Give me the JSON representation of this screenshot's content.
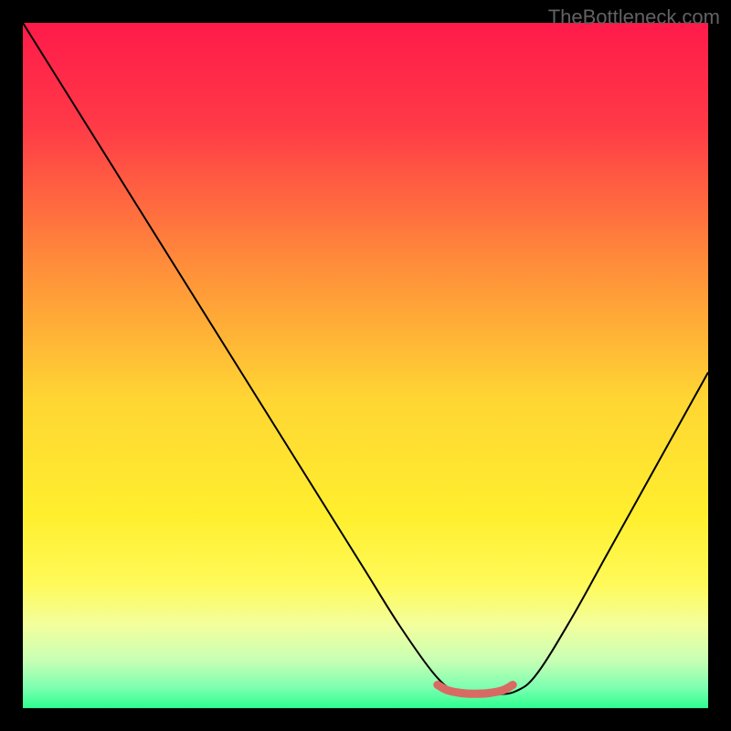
{
  "watermark": "TheBottleneck.com",
  "chart_data": {
    "type": "line",
    "title": "",
    "xlabel": "",
    "ylabel": "",
    "xlim": [
      0,
      100
    ],
    "ylim": [
      0,
      100
    ],
    "background_gradient": {
      "stops": [
        {
          "pos": 0.0,
          "color": "#ff1a4a"
        },
        {
          "pos": 0.15,
          "color": "#ff3a47"
        },
        {
          "pos": 0.35,
          "color": "#ff8c3a"
        },
        {
          "pos": 0.55,
          "color": "#ffd633"
        },
        {
          "pos": 0.72,
          "color": "#ffef2e"
        },
        {
          "pos": 0.82,
          "color": "#fffa5a"
        },
        {
          "pos": 0.88,
          "color": "#f2ff9e"
        },
        {
          "pos": 0.93,
          "color": "#c8ffb4"
        },
        {
          "pos": 0.97,
          "color": "#7dffb0"
        },
        {
          "pos": 1.0,
          "color": "#2dff8f"
        }
      ]
    },
    "series": [
      {
        "name": "bottleneck-curve",
        "color": "#000000",
        "width": 2,
        "x": [
          0,
          5,
          10,
          15,
          20,
          25,
          30,
          35,
          40,
          45,
          50,
          55,
          60,
          63,
          66,
          69,
          72,
          75,
          80,
          85,
          90,
          95,
          100
        ],
        "y": [
          100,
          92,
          84,
          76,
          68,
          60,
          52,
          44,
          36,
          28,
          20,
          12,
          5,
          2.5,
          2,
          2,
          2.5,
          5,
          13,
          22,
          31,
          40,
          49
        ]
      },
      {
        "name": "optimal-range-marker",
        "color": "#d96a63",
        "width": 9,
        "linecap": "round",
        "x": [
          60.5,
          62,
          64,
          66,
          68,
          70,
          71.5
        ],
        "y": [
          3.4,
          2.6,
          2.2,
          2.1,
          2.2,
          2.6,
          3.4
        ]
      }
    ]
  }
}
